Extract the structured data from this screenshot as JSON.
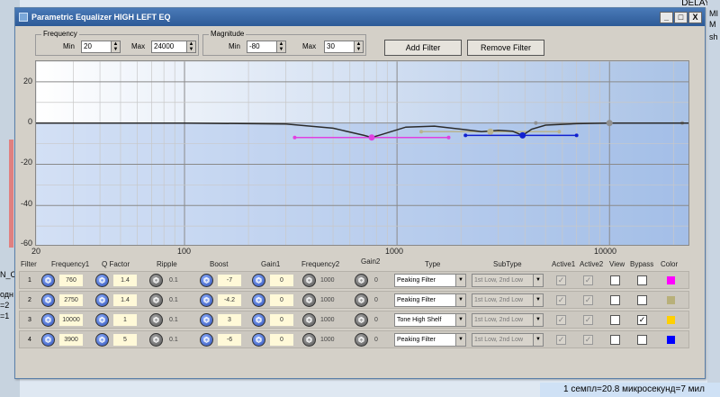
{
  "background": {
    "top_right": "DELAYS",
    "right_snips": [
      "MI",
      "M",
      "sh"
    ],
    "left_snips": [
      "N_C",
      "одн",
      "=2",
      "=1"
    ],
    "bottom_status": "1 семпл=20.8 микросекунд=7 мил"
  },
  "window": {
    "title": "Parametric Equalizer HIGH LEFT EQ",
    "controls": [
      "_",
      "□",
      "X"
    ]
  },
  "frequency": {
    "legend": "Frequency",
    "min_label": "Min",
    "min_value": "20",
    "max_label": "Max",
    "max_value": "24000"
  },
  "magnitude": {
    "legend": "Magnitude",
    "min_label": "Min",
    "min_value": "-80",
    "max_label": "Max",
    "max_value": "30"
  },
  "buttons": {
    "add": "Add Filter",
    "remove": "Remove Filter"
  },
  "chart_data": {
    "type": "line",
    "x_scale": "log",
    "xlim": [
      20,
      24000
    ],
    "ylim": [
      -60,
      30
    ],
    "x_ticks": [
      "20",
      "100",
      "1000",
      "10000"
    ],
    "y_ticks": [
      "20",
      "0",
      "-20",
      "-40",
      "-60"
    ],
    "grid": true,
    "series": [
      {
        "color": "#2b2b2b",
        "x": [
          20,
          100,
          300,
          500,
          700,
          760,
          850,
          1100,
          1500,
          2000,
          2500,
          3000,
          3500,
          3900,
          4300,
          5000,
          7000,
          10000,
          24000
        ],
        "y": [
          0,
          0,
          -0.5,
          -2.5,
          -6,
          -7,
          -5.5,
          -2,
          -1.5,
          -3,
          -4.2,
          -3.5,
          -4,
          -6,
          -3,
          -1,
          -0.3,
          0,
          0
        ]
      }
    ],
    "filters": [
      {
        "freq": 760,
        "gain": -7,
        "bw_low": 330,
        "bw_high": 1750,
        "color": "#e040e0"
      },
      {
        "freq": 2750,
        "gain": -4.2,
        "bw_low": 1300,
        "bw_high": 5800,
        "color": "#b8b490"
      },
      {
        "freq": 3900,
        "gain": -6,
        "bw_low": 2100,
        "bw_high": 7000,
        "color": "#1020d0"
      },
      {
        "freq": 10000,
        "gain": 0,
        "bw_low": 4500,
        "bw_high": 22000,
        "color": "#909090"
      }
    ]
  },
  "table": {
    "headers": [
      "Filter",
      "Frequency1",
      "Q Factor",
      "Ripple",
      "Boost",
      "Gain1",
      "Frequency2",
      "Gain2",
      "Type",
      "SubType",
      "Active1",
      "Active2",
      "View",
      "Bypass",
      "Color"
    ],
    "rows": [
      {
        "index": "1",
        "freq1": "760",
        "q": "1.4",
        "ripple": "0.1",
        "boost": "-7",
        "gain1": "0",
        "freq2": "1000",
        "gain2": "0",
        "type": "Peaking Filter",
        "subtype": "1st Low, 2nd Low",
        "active1": "✓",
        "active2": "✓",
        "view": "",
        "bypass": "",
        "color": "#ff00ff"
      },
      {
        "index": "2",
        "freq1": "2750",
        "q": "1.4",
        "ripple": "0.1",
        "boost": "-4.2",
        "gain1": "0",
        "freq2": "1000",
        "gain2": "0",
        "type": "Peaking Filter",
        "subtype": "1st Low, 2nd Low",
        "active1": "✓",
        "active2": "✓",
        "view": "",
        "bypass": "",
        "color": "#b8b07a"
      },
      {
        "index": "3",
        "freq1": "10000",
        "q": "1",
        "ripple": "0.1",
        "boost": "3",
        "gain1": "0",
        "freq2": "1000",
        "gain2": "0",
        "type": "Tone High Shelf",
        "subtype": "1st Low, 2nd Low",
        "active1": "✓",
        "active2": "✓",
        "view": "",
        "bypass": "✓",
        "color": "#ffd000"
      },
      {
        "index": "4",
        "freq1": "3900",
        "q": "5",
        "ripple": "0.1",
        "boost": "-6",
        "gain1": "0",
        "freq2": "1000",
        "gain2": "0",
        "type": "Peaking Filter",
        "subtype": "1st Low, 2nd Low",
        "active1": "✓",
        "active2": "✓",
        "view": "",
        "bypass": "",
        "color": "#0000ff"
      }
    ]
  }
}
